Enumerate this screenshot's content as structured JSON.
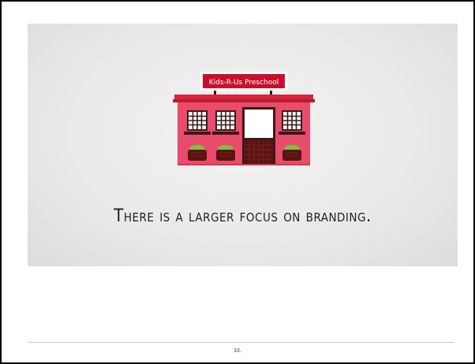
{
  "slide": {
    "sign_text": "Kids-R-Us Preschool",
    "caption": "There is a larger focus on branding."
  },
  "footer": {
    "page_number": "10."
  },
  "colors": {
    "building": "#e94b6a",
    "roof": "#d8243a",
    "sign": "#c8102e",
    "windows": "#3a1a1a",
    "plants": "#7dbf3f",
    "planters": "#5a1212"
  }
}
